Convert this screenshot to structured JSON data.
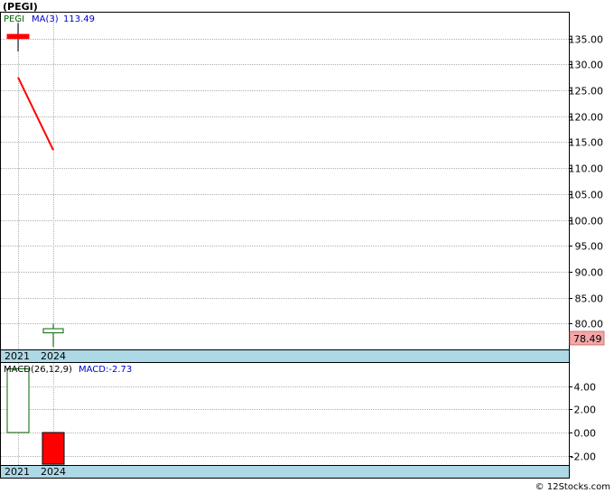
{
  "chart_data": [
    {
      "type": "candlestick",
      "title": "(PEGI)",
      "symbol_label": "PEGI",
      "ma_label": "MA(3)",
      "ma_value_label": "113.49",
      "categories": [
        "2021",
        "2024"
      ],
      "candles": [
        {
          "x": "2021",
          "open": 135.0,
          "close": 135.8,
          "high": 138.0,
          "low": 132.5,
          "direction": "down"
        },
        {
          "x": "2024",
          "open": 78.2,
          "close": 79.0,
          "high": 80.0,
          "low": 75.5,
          "direction": "up"
        }
      ],
      "ma_series": {
        "name": "MA(3)",
        "values": [
          127.5,
          113.49
        ]
      },
      "yticks": [
        135.0,
        130.0,
        125.0,
        120.0,
        115.0,
        110.0,
        105.0,
        100.0,
        95.0,
        90.0,
        85.0,
        80.0
      ],
      "ytick_labels": [
        "135.00",
        "130.00",
        "125.00",
        "120.00",
        "115.00",
        "110.00",
        "105.00",
        "100.00",
        "95.00",
        "90.00",
        "85.00",
        "80.00"
      ],
      "last_price_label": "78.49",
      "last_price": 78.49,
      "ylim": [
        75.0,
        140.0
      ],
      "grid": true
    },
    {
      "type": "bar",
      "indicator_label": "MACD(26,12,9)",
      "macd_value_label": "MACD:-2.73",
      "categories": [
        "2021",
        "2024"
      ],
      "values": [
        5.5,
        -2.73
      ],
      "yticks": [
        4.0,
        2.0,
        0.0,
        -2.0
      ],
      "ytick_labels": [
        "4.00",
        "2.00",
        "0.00",
        "-2.00"
      ],
      "ylim": [
        -2.8,
        6.0
      ],
      "grid": true
    }
  ],
  "footer": {
    "copyright": "© 12Stocks.com"
  },
  "colors": {
    "down": "#ff0000",
    "up_outline": "#006400",
    "ma_line": "#ff0000",
    "grid": "#b0b0b0",
    "axis_band": "#add8e6",
    "price_box": "#f4a7a7",
    "symbol_text": "#006400",
    "ma_text": "#0000cc"
  }
}
